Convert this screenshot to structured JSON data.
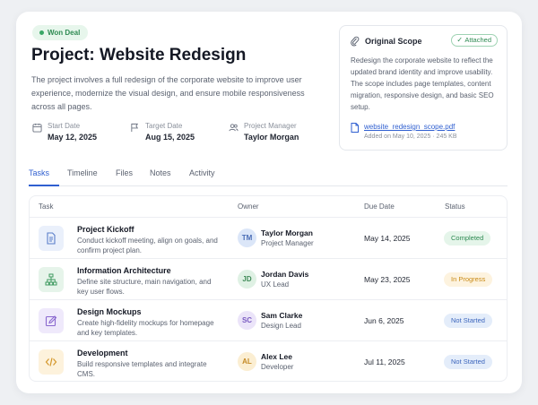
{
  "header": {
    "badge": "Won Deal",
    "title": "Project: Website Redesign",
    "description": "The project involves a full redesign of the corporate website to improve user experience, modernize the visual design, and ensure mobile responsiveness across all pages."
  },
  "meta": [
    {
      "label": "Start Date",
      "value": "May 12, 2025",
      "icon": "calendar-icon"
    },
    {
      "label": "Target Date",
      "value": "Aug 15, 2025",
      "icon": "flag-icon"
    },
    {
      "label": "Project Manager",
      "value": "Taylor Morgan",
      "icon": "users-icon"
    }
  ],
  "scope": {
    "title": "Original Scope",
    "attached": "Attached",
    "description": "Redesign the corporate website to reflect the updated brand identity and improve usability. The scope includes page templates, content migration, responsive design, and basic SEO setup.",
    "file_name": "website_redesign_scope.pdf",
    "file_meta": "Added on May 10, 2025 · 245 KB"
  },
  "tabs": [
    "Tasks",
    "Timeline",
    "Files",
    "Notes",
    "Activity"
  ],
  "table": {
    "headers": [
      "Task",
      "Owner",
      "Due Date",
      "Status"
    ],
    "rows": [
      {
        "task": "Project Kickoff",
        "desc": "Conduct kickoff meeting, align on goals, and confirm project plan.",
        "icon": "document-icon",
        "initials": "TM",
        "owner": "Taylor Morgan",
        "role": "Project Manager",
        "due": "May 14, 2025",
        "status": "Completed"
      },
      {
        "task": "Information Architecture",
        "desc": "Define site structure, main navigation, and key user flows.",
        "icon": "sitemap-icon",
        "initials": "JD",
        "owner": "Jordan Davis",
        "role": "UX Lead",
        "due": "May 23, 2025",
        "status": "In Progress"
      },
      {
        "task": "Design Mockups",
        "desc": "Create high-fidelity mockups for homepage and key templates.",
        "icon": "edit-icon",
        "initials": "SC",
        "owner": "Sam Clarke",
        "role": "Design Lead",
        "due": "Jun 6, 2025",
        "status": "Not Started"
      },
      {
        "task": "Development",
        "desc": "Build responsive templates and integrate CMS.",
        "icon": "code-icon",
        "initials": "AL",
        "owner": "Alex Lee",
        "role": "Developer",
        "due": "Jul 11, 2025",
        "status": "Not Started"
      }
    ]
  },
  "colors": {
    "accent": "#2f5fd0",
    "success": "#2e8a52",
    "warning": "#c98a16"
  }
}
